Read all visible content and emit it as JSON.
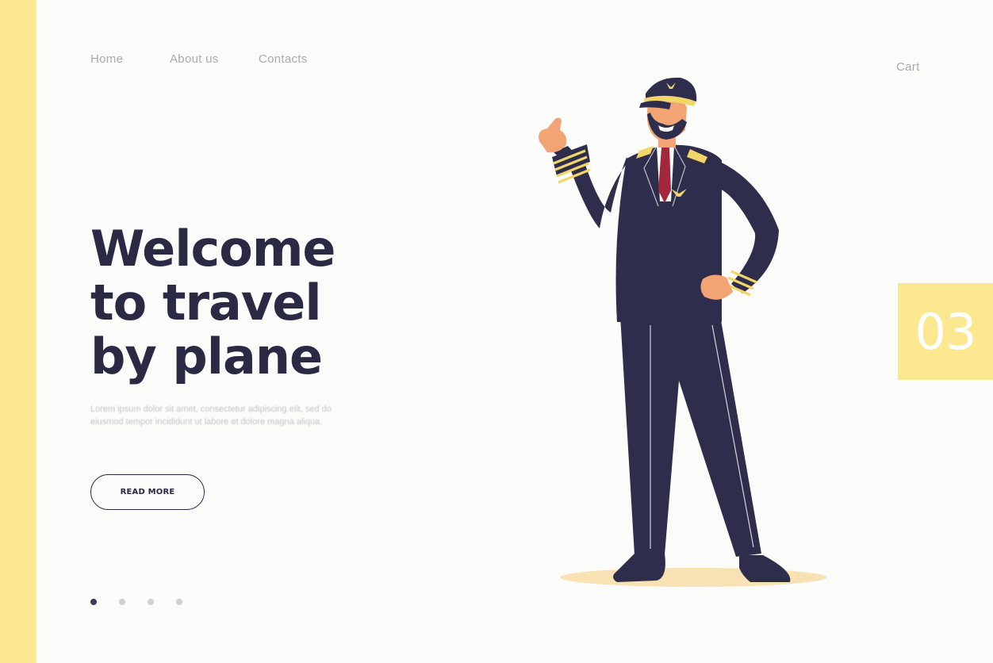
{
  "nav": {
    "items": [
      "Home",
      "About us",
      "Contacts"
    ],
    "cart": "Cart"
  },
  "hero": {
    "title_lines": [
      "Welcome",
      "to travel",
      "by plane"
    ],
    "body": "Lorem ipsum dolor sit amet, consectetur adipiscing elit, sed do eiusmod tempor incididunt ut labore et dolore magna aliqua.",
    "button_label": "READ MORE"
  },
  "slide": {
    "number": "03",
    "total_dots": 4,
    "active_index": 0
  },
  "illustration": {
    "icon": "pilot-illustration",
    "colors": {
      "uniform": "#2e2e4c",
      "skin": "#f3a475",
      "stripes": "#f2d66a",
      "tie": "#a3283c",
      "shadow": "#f8e2b4"
    }
  },
  "colors": {
    "accent": "#fbe891",
    "text": "#2a2a44",
    "muted": "#a9a9b6"
  }
}
